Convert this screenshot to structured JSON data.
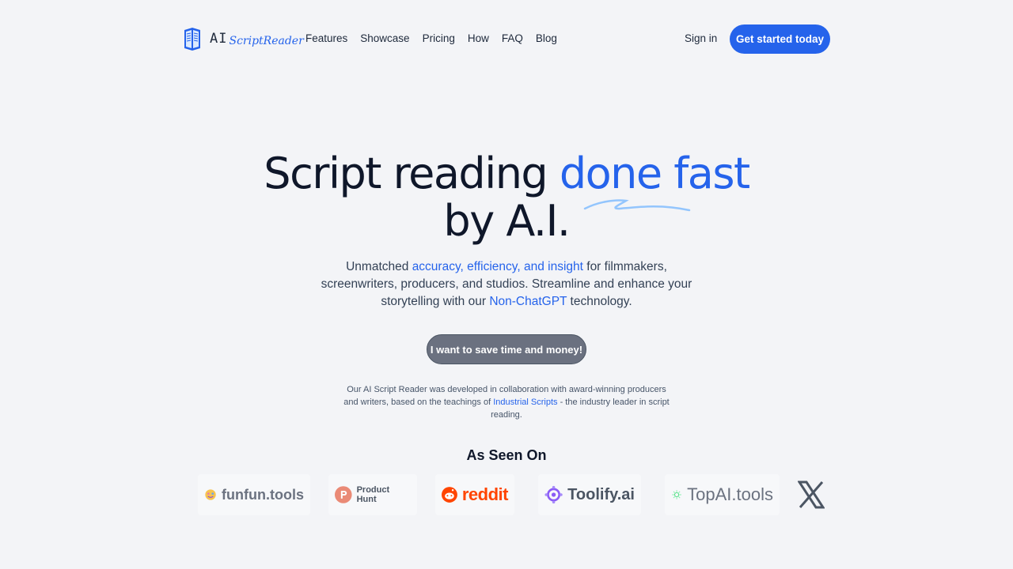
{
  "nav": {
    "logo_ai": "AI",
    "logo_script": "ScriptReader",
    "links": [
      "Features",
      "Showcase",
      "Pricing",
      "How",
      "FAQ",
      "Blog"
    ],
    "signin": "Sign in",
    "cta": "Get started today"
  },
  "hero": {
    "title_part1": "Script reading ",
    "title_highlight": "done fast",
    "title_part2": " by A.I.",
    "sub_part1": "Unmatched ",
    "sub_highlight1": "accuracy, efficiency, and insight",
    "sub_part2": " for filmmakers, screenwriters, producers, and studios. Streamline and enhance your storytelling with our ",
    "sub_highlight2": "Non-ChatGPT",
    "sub_part3": " technology.",
    "cta": "I want to save time and money!",
    "collab_part1": "Our AI Script Reader was developed in collaboration with award-winning producers and writers, based on the teachings of ",
    "collab_link": "Industrial Scripts",
    "collab_part2": " - the industry leader in script reading."
  },
  "seen_on": {
    "title": "As Seen On",
    "brands": [
      "funfun.tools",
      "Product Hunt",
      "reddit",
      "Toolify.ai",
      "TopAI.tools",
      "X"
    ]
  },
  "colors": {
    "accent": "#2563eb",
    "background": "#f3f4f7",
    "secondary_button": "#6b7180",
    "reddit": "#ff4500",
    "product_hunt": "#ea8a76"
  }
}
